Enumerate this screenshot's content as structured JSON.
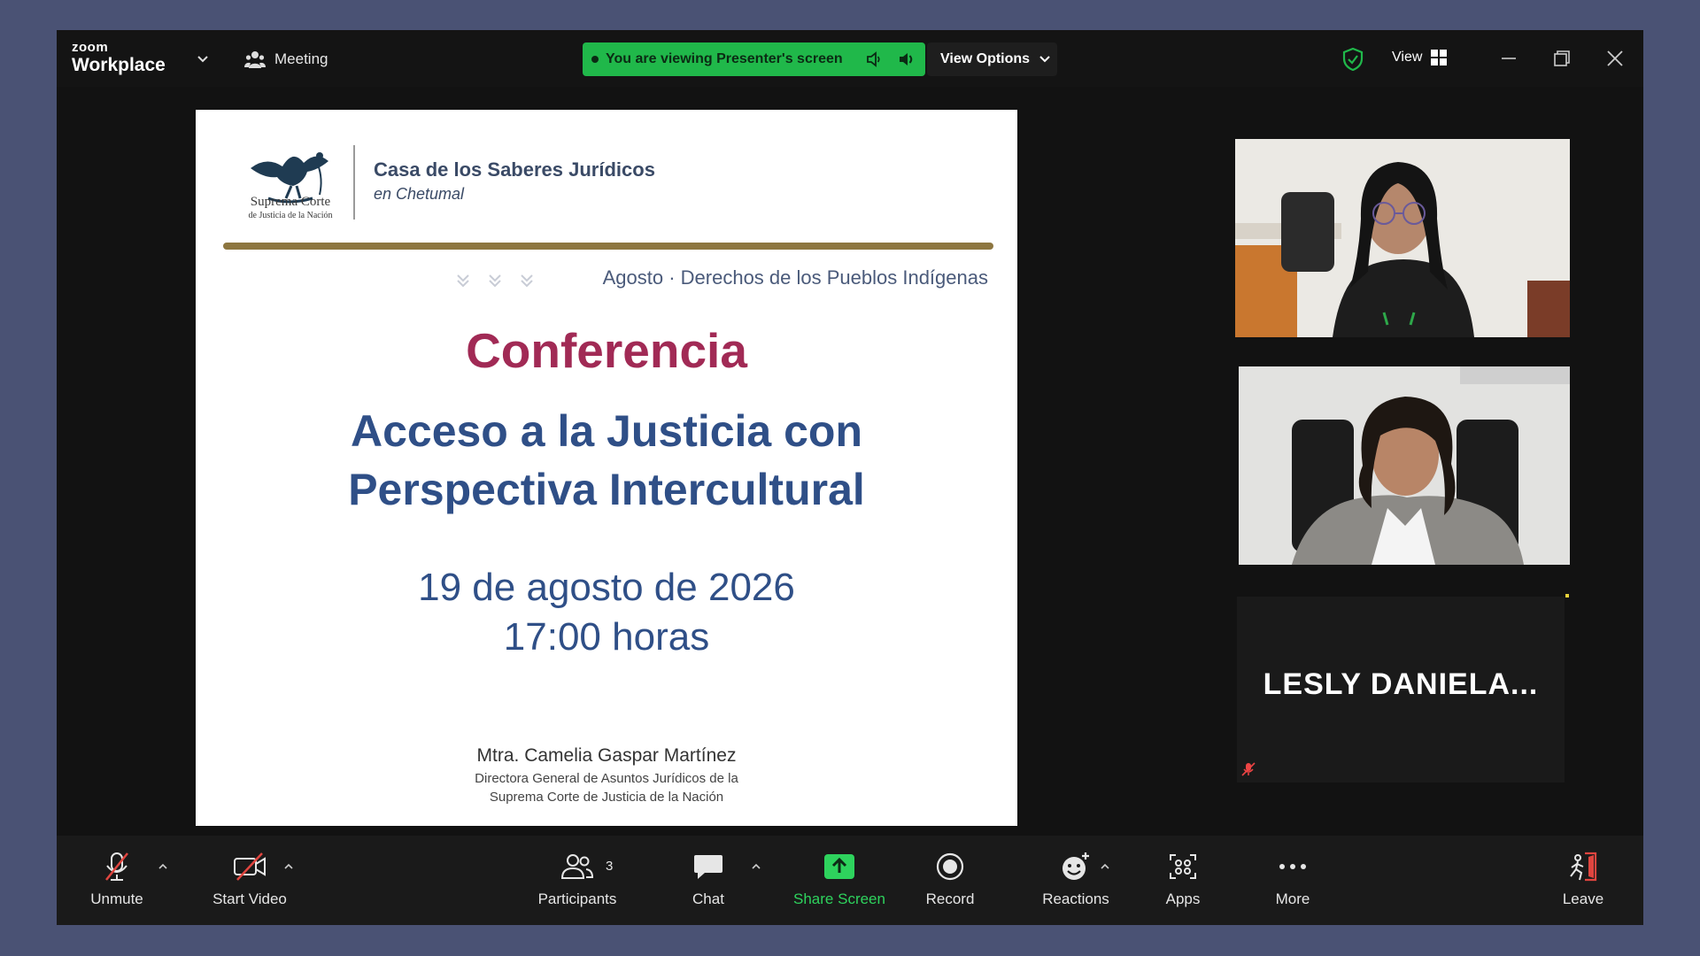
{
  "app": {
    "logo_top": "zoom",
    "logo_bottom": "Workplace",
    "meeting_label": "Meeting"
  },
  "header": {
    "viewing_banner": "You are viewing Presenter's screen",
    "view_options_label": "View Options",
    "view_label": "View",
    "accent_color": "#20b84a"
  },
  "slide": {
    "crest_line1": "Suprema Corte",
    "crest_line2": "de Justicia de la Nación",
    "org_name": "Casa de los Saberes Jurídicos",
    "org_city": "en Chetumal",
    "month_theme": "Agosto · Derechos de los Pueblos Indígenas",
    "kind": "Conferencia",
    "title_line1": "Acceso a la Justicia con",
    "title_line2": "Perspectiva Intercultural",
    "date": "19 de agosto de 2026",
    "time": "17:00 horas",
    "speaker_name": "Mtra. Camelia Gaspar Martínez",
    "speaker_role_line1": "Directora General de Asuntos Jurídicos de la",
    "speaker_role_line2": "Suprema Corte de Justicia de la Nación"
  },
  "gallery": {
    "tile3_name": "LESLY  DANIELA..."
  },
  "toolbar": {
    "unmute": "Unmute",
    "start_video": "Start Video",
    "participants": "Participants",
    "participants_count": "3",
    "chat": "Chat",
    "share_screen": "Share Screen",
    "record": "Record",
    "reactions": "Reactions",
    "apps": "Apps",
    "more": "More",
    "leave": "Leave"
  }
}
